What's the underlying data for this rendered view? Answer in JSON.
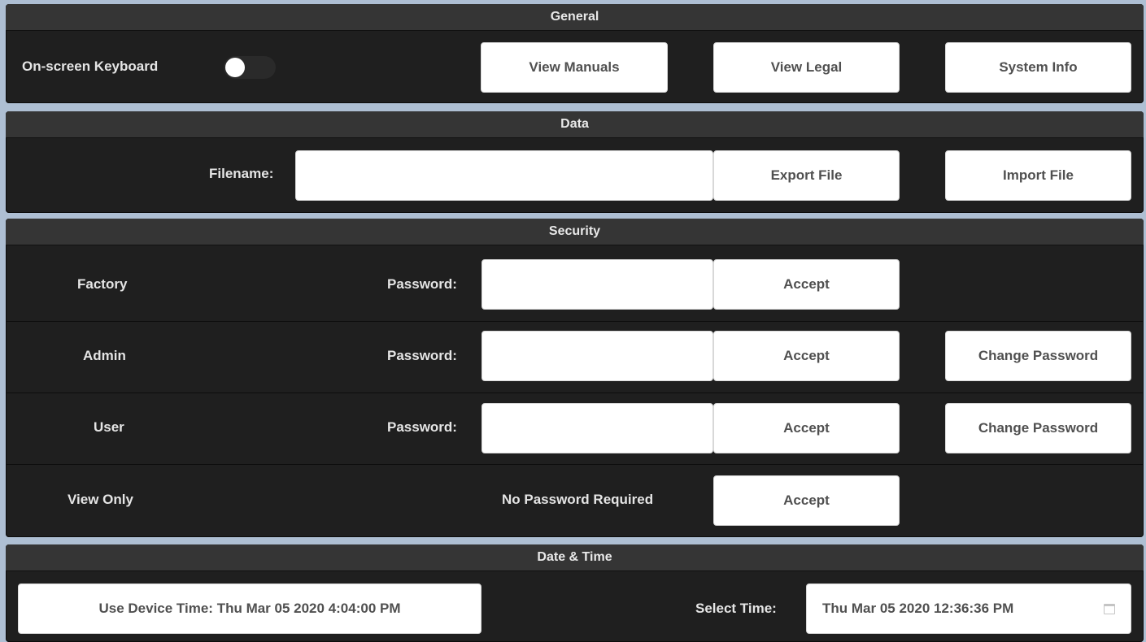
{
  "general": {
    "title": "General",
    "keyboard_label": "On-screen Keyboard",
    "keyboard_on": false,
    "view_manuals": "View Manuals",
    "view_legal": "View Legal",
    "system_info": "System Info"
  },
  "data": {
    "title": "Data",
    "filename_label": "Filename:",
    "filename_value": "",
    "export": "Export File",
    "import": "Import File"
  },
  "security": {
    "title": "Security",
    "rows": [
      {
        "role": "Factory",
        "password_label": "Password:",
        "accept": "Accept"
      },
      {
        "role": "Admin",
        "password_label": "Password:",
        "accept": "Accept",
        "change": "Change Password"
      },
      {
        "role": "User",
        "password_label": "Password:",
        "accept": "Accept",
        "change": "Change Password"
      },
      {
        "role": "View Only",
        "no_password": "No Password Required",
        "accept": "Accept"
      }
    ]
  },
  "datetime": {
    "title": "Date & Time",
    "use_device": "Use Device Time: Thu Mar 05 2020 4:04:00 PM",
    "select_label": "Select Time:",
    "select_value": "Thu Mar 05 2020 12:36:36 PM",
    "icon": "calendar-icon"
  }
}
